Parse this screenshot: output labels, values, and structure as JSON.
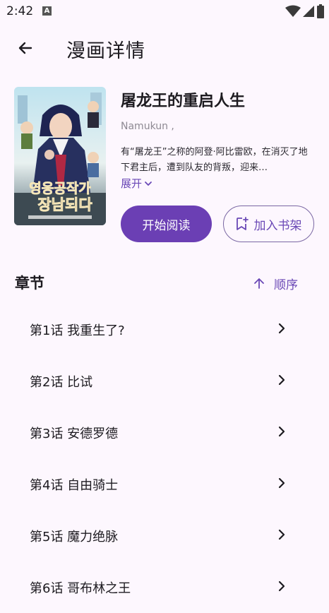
{
  "status": {
    "time": "2:42",
    "notification_badge": "A"
  },
  "app_bar": {
    "title": "漫画详情"
  },
  "comic": {
    "title": "屠龙王的重启人生",
    "author": "Namukun ,",
    "description": "有“屠龙王”之称的阿登·阿比雷欧，在消灭了地下君主后，遭到队友的背叛，迎来…",
    "expand_label": "展开",
    "cover_text_top": "영웅공작가",
    "cover_text_bottom": "장남되다"
  },
  "actions": {
    "read_label": "开始阅读",
    "shelf_label": "加入书架"
  },
  "chapters": {
    "heading": "章节",
    "sort_label": "顺序",
    "items": [
      {
        "label": "第1话 我重生了?"
      },
      {
        "label": "第2话 比试"
      },
      {
        "label": "第3话 安德罗德"
      },
      {
        "label": "第4话 自由骑士"
      },
      {
        "label": "第5话 魔力绝脉"
      },
      {
        "label": "第6话 哥布林之王"
      }
    ]
  },
  "colors": {
    "accent": "#6b3fb4",
    "background": "#fdf7fe",
    "text": "#1d1b20"
  }
}
